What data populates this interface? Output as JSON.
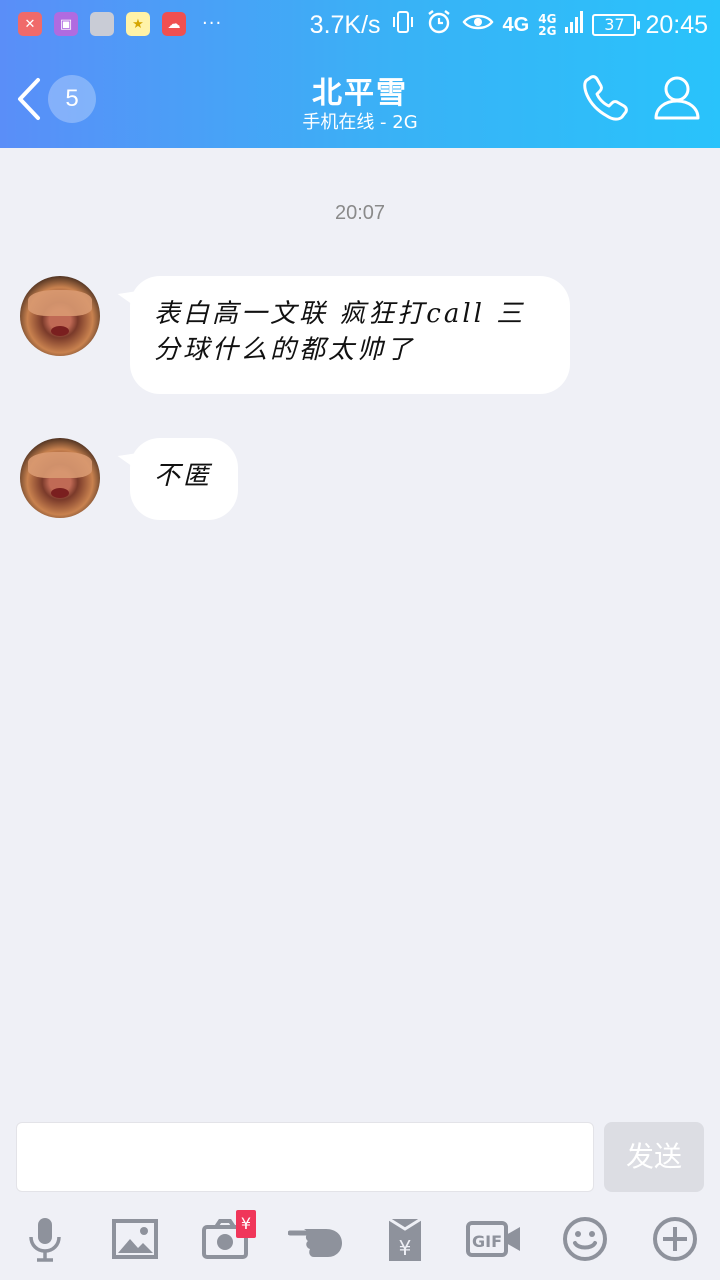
{
  "status_bar": {
    "network_speed": "3.7K/s",
    "network_type": "4G",
    "secondary_network_top": "4G",
    "secondary_network_bottom": "2G",
    "battery_level": "37",
    "time": "20:45",
    "more_notifications": "···"
  },
  "header": {
    "unread_count": "5",
    "contact_name": "北平雪",
    "contact_status": "手机在线 - 2G"
  },
  "chat": {
    "timestamp": "20:07",
    "messages": [
      {
        "text": "表白高一文联 疯狂打call 三分球什么的都太帅了"
      },
      {
        "text": "不匿"
      }
    ]
  },
  "input": {
    "value": "",
    "send_label": "发送"
  },
  "toolbar": {
    "redpacket_badge": "¥",
    "gif_label": "GIF"
  },
  "colors": {
    "header_gradient_start": "#5a8ef8",
    "header_gradient_end": "#29c3fb",
    "background": "#eff0f6",
    "send_button_disabled": "#dcdde3",
    "toolbar_icon": "#8e929c",
    "redpacket_badge": "#f0365a"
  }
}
